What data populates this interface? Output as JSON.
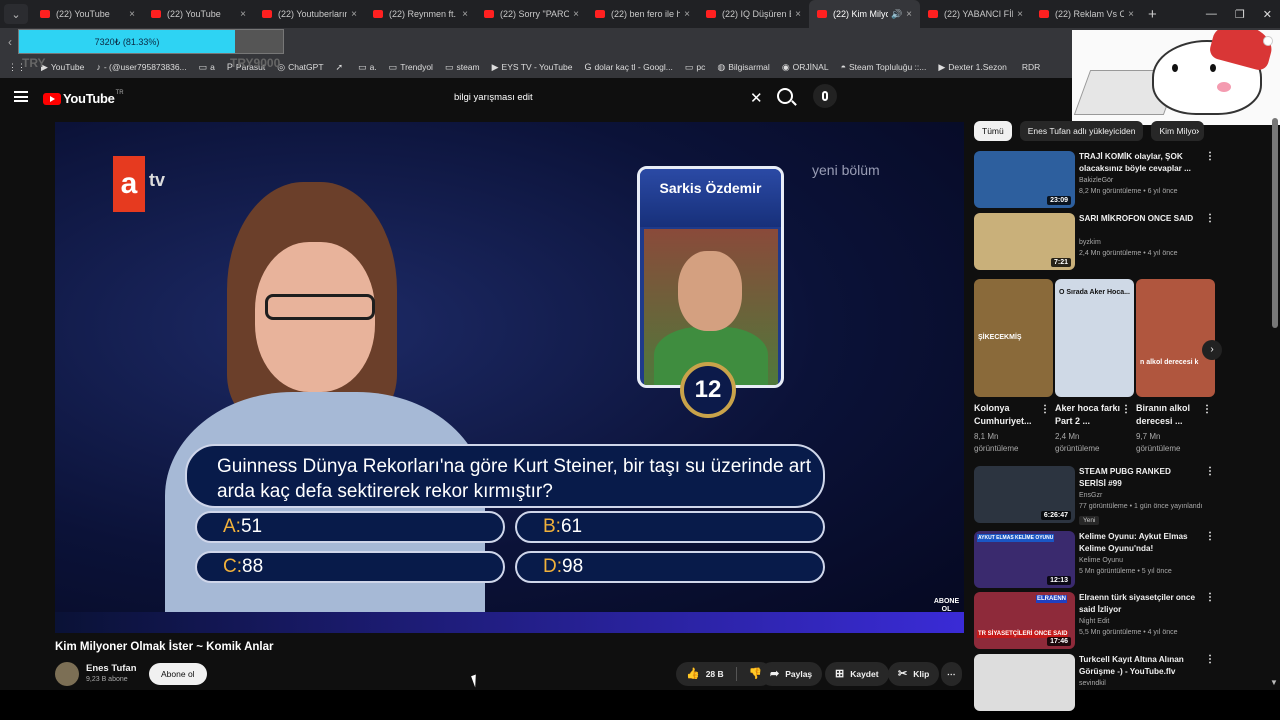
{
  "browser": {
    "tabs": [
      {
        "title": "(22) YouTube",
        "active": false
      },
      {
        "title": "(22) YouTube",
        "active": false
      },
      {
        "title": "(22) Youtuberların",
        "active": false
      },
      {
        "title": "(22) Reynmen ft. V",
        "active": false
      },
      {
        "title": "(22) Sorry \"PAROD",
        "active": false
      },
      {
        "title": "(22) ben fero ile h",
        "active": false
      },
      {
        "title": "(22) IQ Düşüren B",
        "active": false
      },
      {
        "title": "(22) Kim Milyo",
        "active": true
      },
      {
        "title": "(22) YABANCI FİLM",
        "active": false
      },
      {
        "title": "(22) Reklam Vs O",
        "active": false
      }
    ],
    "close_glyph": "×",
    "new_tab": "+",
    "tab_menu": "⌄",
    "win_min": "—",
    "win_max": "❐",
    "win_close": "✕",
    "nav_back": "‹",
    "speaker_glyph": "🔊",
    "addr_more": "⋮",
    "bookmarks_more": "»",
    "bookmarks": [
      {
        "icon": "⋮⋮",
        "label": ""
      },
      {
        "icon": "▶",
        "label": "YouTube"
      },
      {
        "icon": "♪",
        "label": "- (@user795873836..."
      },
      {
        "icon": "▭",
        "label": "a"
      },
      {
        "icon": "P",
        "label": "Parasut"
      },
      {
        "icon": "◎",
        "label": "ChatGPT"
      },
      {
        "icon": "➚",
        "label": ""
      },
      {
        "icon": "▭",
        "label": "a."
      },
      {
        "icon": "▭",
        "label": "Trendyol"
      },
      {
        "icon": "▭",
        "label": "steam"
      },
      {
        "icon": "▶",
        "label": "EYS TV - YouTube"
      },
      {
        "icon": "G",
        "label": "dolar kaç tl - Googl..."
      },
      {
        "icon": "▭",
        "label": "pc"
      },
      {
        "icon": "◍",
        "label": "Bilgisarmal"
      },
      {
        "icon": "◉",
        "label": "ORJİNAL"
      },
      {
        "icon": "◓",
        "label": "Steam Topluluğu ::..."
      },
      {
        "icon": "▶",
        "label": "Dexter 1.Sezon"
      },
      {
        "icon": "",
        "label": "RDR"
      }
    ]
  },
  "overlay": {
    "progress_text": "7320₺ (81.33%)",
    "progress_fraction": 0.8133,
    "ghost_left": "TRY",
    "ghost_right": "TRY9000"
  },
  "youtube": {
    "logo": "YouTube",
    "country": "TR",
    "search_value": "bilgi yarışması edit",
    "clear_glyph": "✕"
  },
  "video": {
    "channel_logo_a": "a",
    "channel_logo_tv": "tv",
    "corner_label": "yeni bölüm",
    "contestant_card_name": "Sarkis Özdemir",
    "timer": "12",
    "question": "Guinness Dünya Rekorları'na göre Kurt Steiner, bir taşı su üzerinde art arda kaç defa sektirerek rekor kırmıştır?",
    "answers": [
      {
        "key": "A:",
        "value": "51"
      },
      {
        "key": "B:",
        "value": "61"
      },
      {
        "key": "C:",
        "value": "88"
      },
      {
        "key": "D:",
        "value": "98"
      }
    ],
    "watermark": "ABONE OL"
  },
  "meta": {
    "title": "Kim Milyoner Olmak İster ~ Komik Anlar",
    "channel": "Enes Tufan",
    "subscribers": "9,23 B abone",
    "subscribe_label": "Abone ol",
    "likes": "28 B",
    "like_icon": "👍",
    "dislike_icon": "👎",
    "share_icon": "➦",
    "save_icon": "⊞",
    "clip_icon": "✂",
    "share_label": "Paylaş",
    "save_label": "Kaydet",
    "clip_label": "Klip",
    "more_glyph": "⋯"
  },
  "sidebar": {
    "chips": [
      {
        "label": "Tümü",
        "active": true
      },
      {
        "label": "Enes Tufan adlı yükleyiciden",
        "active": false
      },
      {
        "label": "Kim Milyo",
        "active": false
      }
    ],
    "chip_next": "›",
    "videos_top": [
      {
        "title": "TRAJİ KOMİK olaylar, ŞOK olacaksınız böyle cevaplar ...",
        "channel": "BakizleGör",
        "meta": "8,2 Mn görüntüleme • 6 yıl önce",
        "duration": "23:09",
        "color": "#2d5f9e"
      },
      {
        "title": "SARI MİKROFON ONCE SAID",
        "channel": "byzkim",
        "meta": "2,4 Mn görüntüleme • 4 yıl önce",
        "duration": "7:21",
        "color": "#c9b07a"
      }
    ],
    "shorts": [
      {
        "title": "Kolonya Cumhuriyet...",
        "views": "8,1 Mn görüntüleme",
        "color": "#8a6a3a",
        "overlay": "ŞİKECEKMİŞ"
      },
      {
        "title": "Aker hoca farkı Part 2 ...",
        "views": "2,4 Mn görüntüleme",
        "color": "#cfd9e6",
        "overlay": "O Sırada Aker Hoca..."
      },
      {
        "title": "Biranın alkol derecesi ...",
        "views": "9,7 Mn görüntüleme",
        "color": "#b0563e",
        "overlay": "n alkol derecesi k"
      }
    ],
    "shorts_next": "›",
    "kebab": "⋮",
    "videos_bottom": [
      {
        "title": "STEAM PUBG RANKED SERİSİ #99",
        "channel": "EnsGzr",
        "meta": "77 görüntüleme • 1 gün önce yayınlandı",
        "duration": "6:26:47",
        "badge": "Yeni",
        "color": "#2c3440"
      },
      {
        "title": "Kelime Oyunu: Aykut Elmas Kelime Oyunu'nda!",
        "channel": "Kelime Oyunu",
        "meta": "5 Mn görüntüleme • 5 yıl önce",
        "duration": "12:13",
        "badge": "",
        "color": "#3a2a6e"
      },
      {
        "title": "Elraenn türk siyasetçiler once said İzliyor",
        "channel": "Night Edit",
        "meta": "5,5 Mn görüntüleme • 4 yıl önce",
        "duration": "17:46",
        "badge": "",
        "color": "#8e2a3a"
      },
      {
        "title": "Turkcell Kayıt Altına Alınan Görüşme -) - YouTube.flv",
        "channel": "sevindkil",
        "meta": "",
        "duration": "",
        "badge": "",
        "color": "#dddddd"
      }
    ],
    "thumb_captions": {
      "kelime": "AYKUT ELMAS KELİME OYUNU",
      "siyaset": "TR SİYASETÇİLERİ ONCE SAID",
      "elraenn": "ELRAENN"
    }
  }
}
